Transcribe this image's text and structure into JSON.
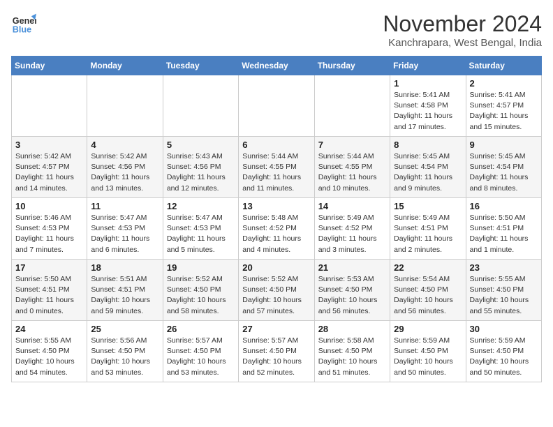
{
  "header": {
    "logo_line1": "General",
    "logo_line2": "Blue",
    "month_title": "November 2024",
    "location": "Kanchrapara, West Bengal, India"
  },
  "weekdays": [
    "Sunday",
    "Monday",
    "Tuesday",
    "Wednesday",
    "Thursday",
    "Friday",
    "Saturday"
  ],
  "weeks": [
    [
      {
        "day": "",
        "info": ""
      },
      {
        "day": "",
        "info": ""
      },
      {
        "day": "",
        "info": ""
      },
      {
        "day": "",
        "info": ""
      },
      {
        "day": "",
        "info": ""
      },
      {
        "day": "1",
        "info": "Sunrise: 5:41 AM\nSunset: 4:58 PM\nDaylight: 11 hours\nand 17 minutes."
      },
      {
        "day": "2",
        "info": "Sunrise: 5:41 AM\nSunset: 4:57 PM\nDaylight: 11 hours\nand 15 minutes."
      }
    ],
    [
      {
        "day": "3",
        "info": "Sunrise: 5:42 AM\nSunset: 4:57 PM\nDaylight: 11 hours\nand 14 minutes."
      },
      {
        "day": "4",
        "info": "Sunrise: 5:42 AM\nSunset: 4:56 PM\nDaylight: 11 hours\nand 13 minutes."
      },
      {
        "day": "5",
        "info": "Sunrise: 5:43 AM\nSunset: 4:56 PM\nDaylight: 11 hours\nand 12 minutes."
      },
      {
        "day": "6",
        "info": "Sunrise: 5:44 AM\nSunset: 4:55 PM\nDaylight: 11 hours\nand 11 minutes."
      },
      {
        "day": "7",
        "info": "Sunrise: 5:44 AM\nSunset: 4:55 PM\nDaylight: 11 hours\nand 10 minutes."
      },
      {
        "day": "8",
        "info": "Sunrise: 5:45 AM\nSunset: 4:54 PM\nDaylight: 11 hours\nand 9 minutes."
      },
      {
        "day": "9",
        "info": "Sunrise: 5:45 AM\nSunset: 4:54 PM\nDaylight: 11 hours\nand 8 minutes."
      }
    ],
    [
      {
        "day": "10",
        "info": "Sunrise: 5:46 AM\nSunset: 4:53 PM\nDaylight: 11 hours\nand 7 minutes."
      },
      {
        "day": "11",
        "info": "Sunrise: 5:47 AM\nSunset: 4:53 PM\nDaylight: 11 hours\nand 6 minutes."
      },
      {
        "day": "12",
        "info": "Sunrise: 5:47 AM\nSunset: 4:53 PM\nDaylight: 11 hours\nand 5 minutes."
      },
      {
        "day": "13",
        "info": "Sunrise: 5:48 AM\nSunset: 4:52 PM\nDaylight: 11 hours\nand 4 minutes."
      },
      {
        "day": "14",
        "info": "Sunrise: 5:49 AM\nSunset: 4:52 PM\nDaylight: 11 hours\nand 3 minutes."
      },
      {
        "day": "15",
        "info": "Sunrise: 5:49 AM\nSunset: 4:51 PM\nDaylight: 11 hours\nand 2 minutes."
      },
      {
        "day": "16",
        "info": "Sunrise: 5:50 AM\nSunset: 4:51 PM\nDaylight: 11 hours\nand 1 minute."
      }
    ],
    [
      {
        "day": "17",
        "info": "Sunrise: 5:50 AM\nSunset: 4:51 PM\nDaylight: 11 hours\nand 0 minutes."
      },
      {
        "day": "18",
        "info": "Sunrise: 5:51 AM\nSunset: 4:51 PM\nDaylight: 10 hours\nand 59 minutes."
      },
      {
        "day": "19",
        "info": "Sunrise: 5:52 AM\nSunset: 4:50 PM\nDaylight: 10 hours\nand 58 minutes."
      },
      {
        "day": "20",
        "info": "Sunrise: 5:52 AM\nSunset: 4:50 PM\nDaylight: 10 hours\nand 57 minutes."
      },
      {
        "day": "21",
        "info": "Sunrise: 5:53 AM\nSunset: 4:50 PM\nDaylight: 10 hours\nand 56 minutes."
      },
      {
        "day": "22",
        "info": "Sunrise: 5:54 AM\nSunset: 4:50 PM\nDaylight: 10 hours\nand 56 minutes."
      },
      {
        "day": "23",
        "info": "Sunrise: 5:55 AM\nSunset: 4:50 PM\nDaylight: 10 hours\nand 55 minutes."
      }
    ],
    [
      {
        "day": "24",
        "info": "Sunrise: 5:55 AM\nSunset: 4:50 PM\nDaylight: 10 hours\nand 54 minutes."
      },
      {
        "day": "25",
        "info": "Sunrise: 5:56 AM\nSunset: 4:50 PM\nDaylight: 10 hours\nand 53 minutes."
      },
      {
        "day": "26",
        "info": "Sunrise: 5:57 AM\nSunset: 4:50 PM\nDaylight: 10 hours\nand 53 minutes."
      },
      {
        "day": "27",
        "info": "Sunrise: 5:57 AM\nSunset: 4:50 PM\nDaylight: 10 hours\nand 52 minutes."
      },
      {
        "day": "28",
        "info": "Sunrise: 5:58 AM\nSunset: 4:50 PM\nDaylight: 10 hours\nand 51 minutes."
      },
      {
        "day": "29",
        "info": "Sunrise: 5:59 AM\nSunset: 4:50 PM\nDaylight: 10 hours\nand 50 minutes."
      },
      {
        "day": "30",
        "info": "Sunrise: 5:59 AM\nSunset: 4:50 PM\nDaylight: 10 hours\nand 50 minutes."
      }
    ]
  ]
}
